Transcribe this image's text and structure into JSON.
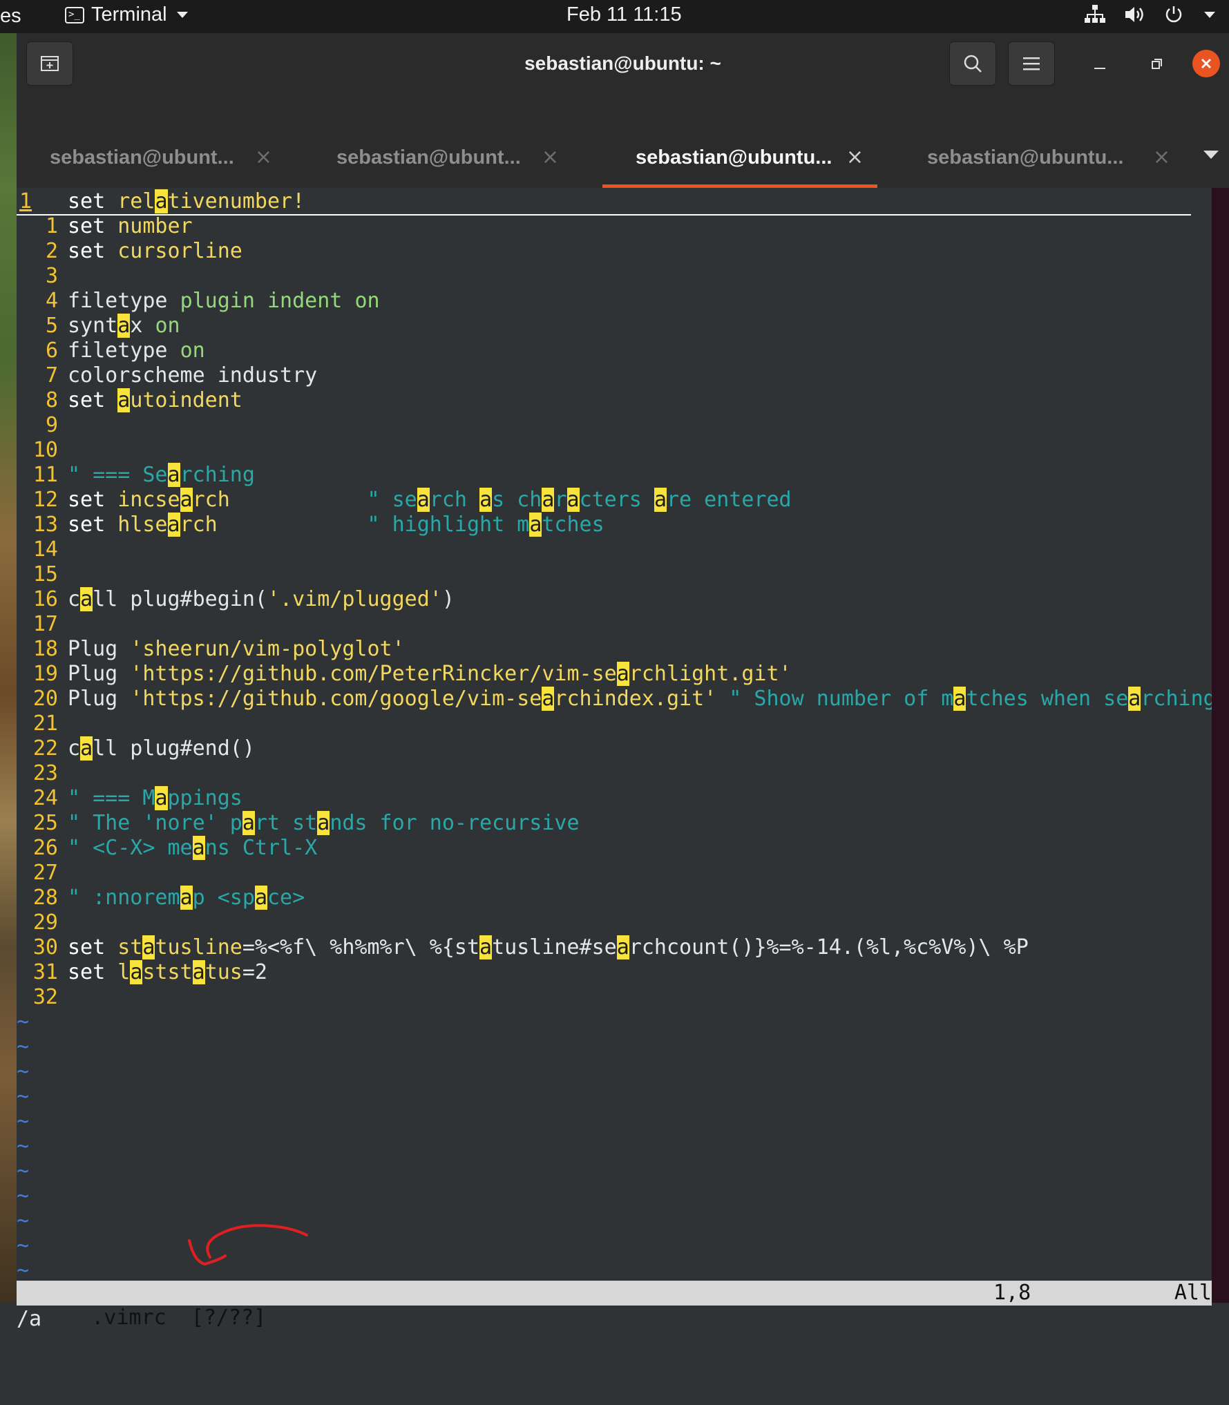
{
  "topbar": {
    "activities": "es",
    "app_name": "Terminal",
    "clock": "Feb 11  11:15"
  },
  "window": {
    "title": "sebastian@ubuntu: ~",
    "tabs": [
      {
        "label": "sebastian@ubunt..."
      },
      {
        "label": "sebastian@ubunt..."
      },
      {
        "label": "sebastian@ubuntu..."
      },
      {
        "label": "sebastian@ubuntu..."
      }
    ],
    "tab_close_glyph": "×"
  },
  "vim": {
    "status": {
      "file": ".vimrc  [?/??]",
      "position": "1,8",
      "percent": "All"
    },
    "cmdline": "/a",
    "lines": [
      {
        "n": "1",
        "html": "<span class='kw'>set</span> <span class='arg'>rel<span class='hl'>a</span>tivenumber!</span>"
      },
      {
        "n": "1",
        "html": "<span class='kw'>set</span> <span class='arg'>number</span>"
      },
      {
        "n": "2",
        "html": "<span class='kw'>set</span> <span class='arg'>cursorline</span>"
      },
      {
        "n": "3",
        "html": ""
      },
      {
        "n": "4",
        "html": "filetype <span class='grn'>plugin</span> <span class='grn'>indent</span> <span class='grn'>on</span>"
      },
      {
        "n": "5",
        "html": "synt<span class='hl'>a</span>x <span class='grn'>on</span>"
      },
      {
        "n": "6",
        "html": "filetype <span class='grn'>on</span>"
      },
      {
        "n": "7",
        "html": "colorscheme industry"
      },
      {
        "n": "8",
        "html": "<span class='kw'>set</span> <span class='arg'><span class='hl'>a</span>utoindent</span>"
      },
      {
        "n": "9",
        "html": ""
      },
      {
        "n": "10",
        "html": ""
      },
      {
        "n": "11",
        "html": "<span class='cmt'>\" === Se<span class='hl'>a</span>rching</span>"
      },
      {
        "n": "12",
        "html": "<span class='kw'>set</span> <span class='arg'>incse<span class='hl'>a</span>rch</span>           <span class='cmt'>\" se<span class='hl'>a</span>rch <span class='hl'>a</span>s ch<span class='hl'>a</span>r<span class='hl'>a</span>cters <span class='hl'>a</span>re entered</span>"
      },
      {
        "n": "13",
        "html": "<span class='kw'>set</span> <span class='arg'>hlse<span class='hl'>a</span>rch</span>            <span class='cmt'>\" highlight m<span class='hl'>a</span>tches</span>"
      },
      {
        "n": "14",
        "html": ""
      },
      {
        "n": "15",
        "html": ""
      },
      {
        "n": "16",
        "html": "c<span class='hl'>a</span>ll plug#begin(<span class='str'>'.vim/plugged'</span>)"
      },
      {
        "n": "17",
        "html": ""
      },
      {
        "n": "18",
        "html": "Plug <span class='str'>'sheerun/vim-polyglot'</span>"
      },
      {
        "n": "19",
        "html": "Plug <span class='str'>'https://github.com/PeterRincker/vim-se<span class='hl'>a</span>rchlight.git'</span>"
      },
      {
        "n": "20",
        "html": "Plug <span class='str'>'https://github.com/google/vim-se<span class='hl'>a</span>rchindex.git'</span> <span class='cmt'>\" Show number of m<span class='hl'>a</span>tches when se<span class='hl'>a</span>rching</span>"
      },
      {
        "n": "21",
        "html": ""
      },
      {
        "n": "22",
        "html": "c<span class='hl'>a</span>ll plug#end()"
      },
      {
        "n": "23",
        "html": ""
      },
      {
        "n": "24",
        "html": "<span class='cmt'>\" === M<span class='hl'>a</span>ppings</span>"
      },
      {
        "n": "25",
        "html": "<span class='cmt'>\" The 'nore' p<span class='hl'>a</span>rt st<span class='hl'>a</span>nds for no-recursive</span>"
      },
      {
        "n": "26",
        "html": "<span class='cmt'>\" &lt;C-X&gt; me<span class='hl'>a</span>ns Ctrl-X</span>"
      },
      {
        "n": "27",
        "html": ""
      },
      {
        "n": "28",
        "html": "<span class='cmt'>\" :nnorem<span class='hl'>a</span>p &lt;sp<span class='hl'>a</span>ce&gt;</span>"
      },
      {
        "n": "29",
        "html": ""
      },
      {
        "n": "30",
        "html": "<span class='kw'>set</span> <span class='arg'>st<span class='hl'>a</span>tusline</span>=%&lt;%f\\ %h%m%r\\ %{st<span class='hl'>a</span>tusline#se<span class='hl'>a</span>rchcount()}%=%-14.(%l,%c%V%)\\ %P"
      },
      {
        "n": "31",
        "html": "<span class='kw'>set</span> <span class='arg'>l<span class='hl'>a</span>stst<span class='hl'>a</span>tus</span>=2"
      },
      {
        "n": "32",
        "html": ""
      }
    ],
    "tilde_count": 11,
    "tilde": "~"
  }
}
